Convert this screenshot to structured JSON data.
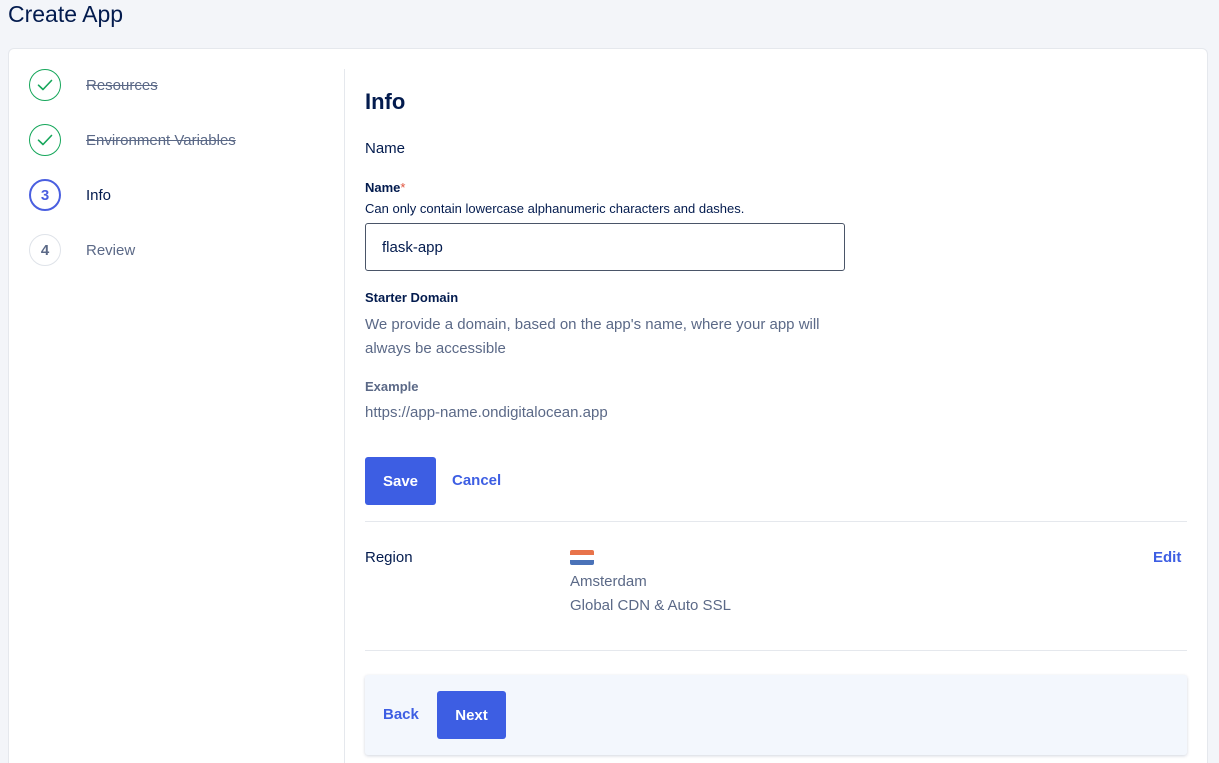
{
  "page": {
    "title": "Create App"
  },
  "steps": [
    {
      "label": "Resources",
      "state": "done",
      "marker": ""
    },
    {
      "label": "Environment Variables",
      "state": "done",
      "marker": ""
    },
    {
      "label": "Info",
      "state": "current",
      "marker": "3"
    },
    {
      "label": "Review",
      "state": "todo",
      "marker": "4"
    }
  ],
  "info": {
    "title": "Info",
    "subtitle": "Name",
    "name_label": "Name",
    "required_mark": "*",
    "name_help": "Can only contain lowercase alphanumeric characters and dashes.",
    "name_value": "flask-app",
    "domain_label": "Starter Domain",
    "domain_desc": "We provide a domain, based on the app's name, where your app will always be accessible",
    "example_label": "Example",
    "example_value": "https://app-name.ondigitalocean.app",
    "save_label": "Save",
    "cancel_label": "Cancel"
  },
  "region": {
    "label": "Region",
    "city": "Amsterdam",
    "extra": "Global CDN & Auto SSL",
    "edit_label": "Edit",
    "flag_colors": [
      "#e8734a",
      "#ffffff",
      "#4a72b8"
    ]
  },
  "footer": {
    "back_label": "Back",
    "next_label": "Next"
  },
  "colors": {
    "accent": "#3d5ee3",
    "success": "#15a65a",
    "text": "#031b4e",
    "muted": "#5b6987"
  }
}
